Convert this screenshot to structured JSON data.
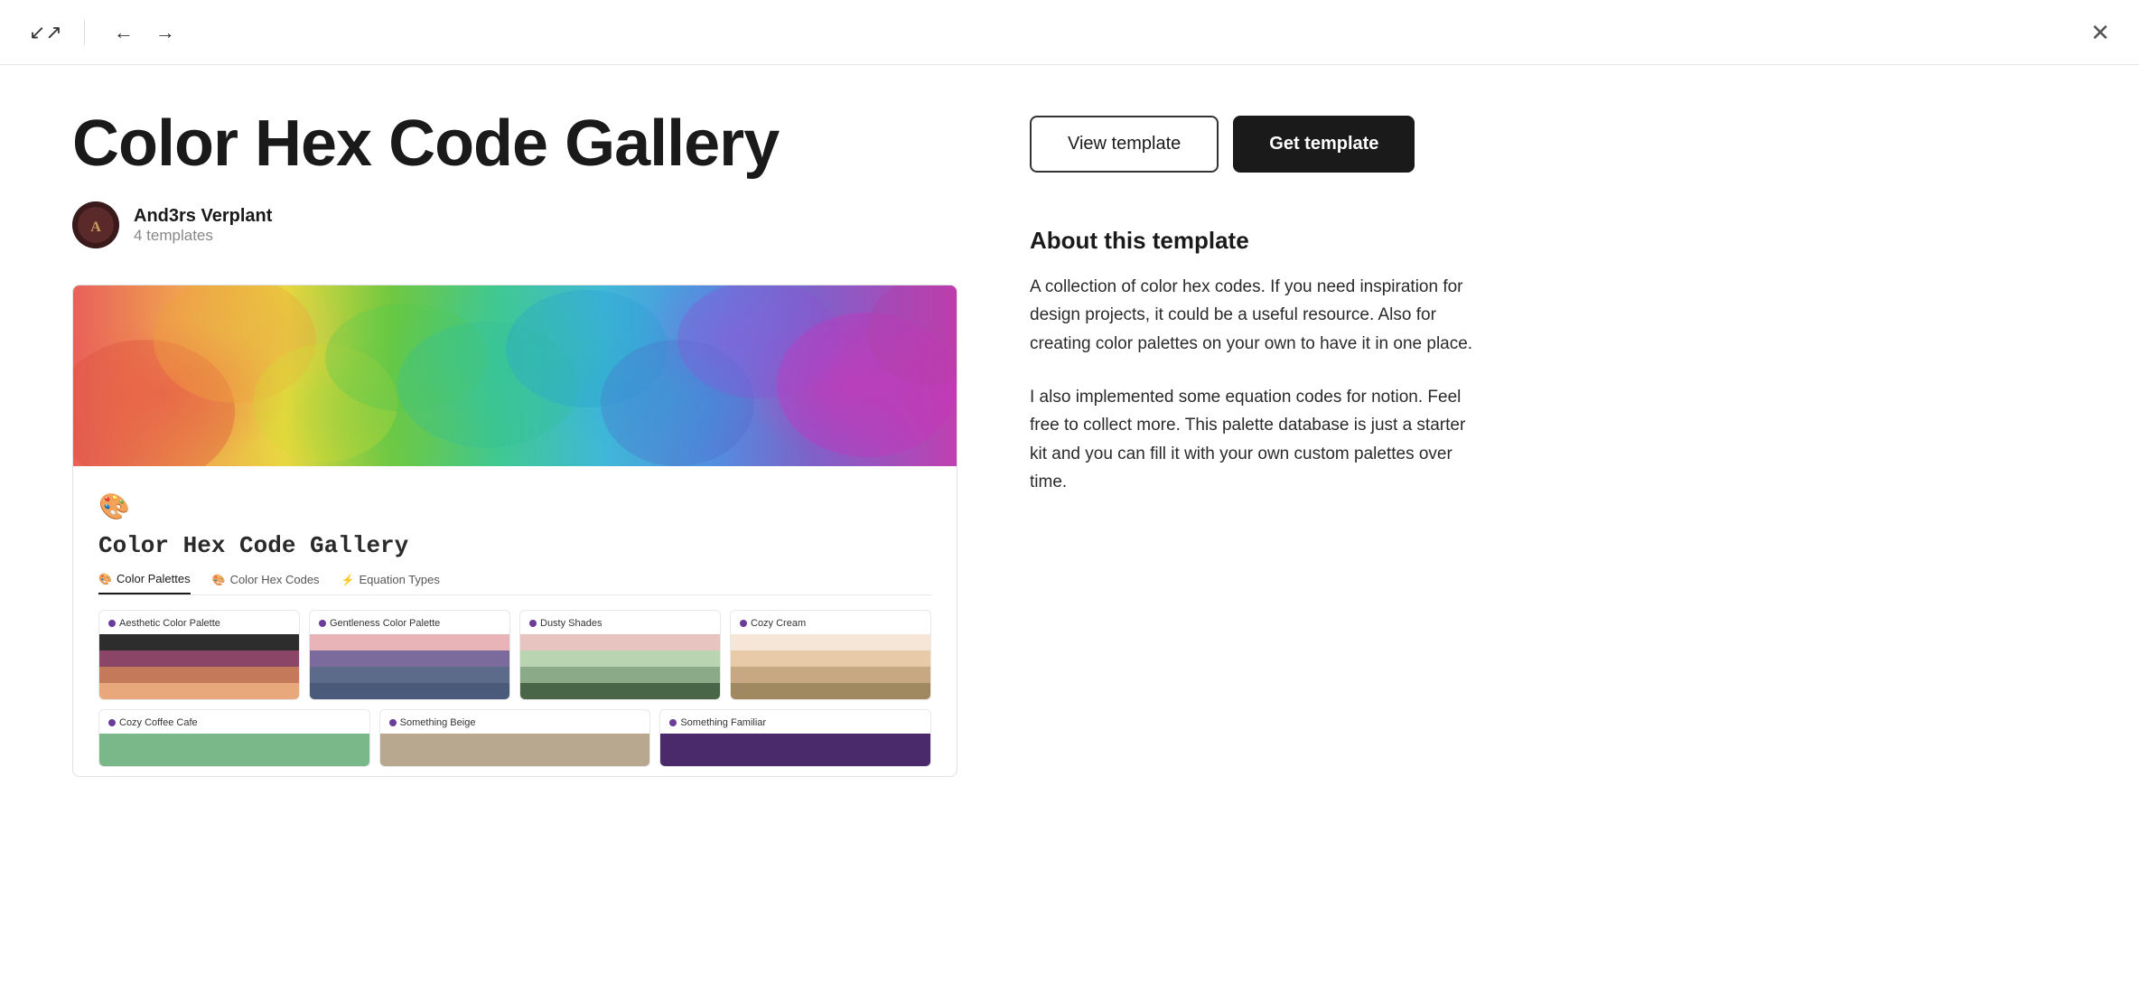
{
  "nav": {
    "expand_icon": "↙↗",
    "back_icon": "←",
    "forward_icon": "→",
    "close_icon": "✕"
  },
  "header": {
    "title": "Color Hex Code Gallery",
    "author_name": "And3rs Verplant",
    "author_templates": "4 templates"
  },
  "buttons": {
    "view_template": "View template",
    "get_template": "Get template"
  },
  "preview": {
    "icon": "🎨",
    "db_title": "Color Hex Code Gallery",
    "tabs": [
      {
        "label": "Color Palettes",
        "icon": "🎨",
        "active": true
      },
      {
        "label": "Color Hex Codes",
        "icon": "🎨",
        "active": false
      },
      {
        "label": "Equation Types",
        "icon": "⚡",
        "active": false
      }
    ],
    "palettes": [
      {
        "name": "Aesthetic Color Palette",
        "dot_color": "#6a3d9a",
        "swatches": [
          "#2d2d2d",
          "#8b4567",
          "#c47a5a",
          "#e8a87c"
        ]
      },
      {
        "name": "Gentleness Color Palette",
        "dot_color": "#6a3d9a",
        "swatches": [
          "#e8b4b8",
          "#7b6b9d",
          "#5c6b8a",
          "#4a5a7a"
        ]
      },
      {
        "name": "Dusty Shades",
        "dot_color": "#6a3d9a",
        "swatches": [
          "#e8c4c0",
          "#b8d4b0",
          "#8aaa88",
          "#4a6648"
        ]
      },
      {
        "name": "Cozy Cream",
        "dot_color": "#6a3d9a",
        "swatches": [
          "#f5e6d8",
          "#e8c9a8",
          "#c8a882",
          "#a08860"
        ]
      }
    ],
    "palettes_row2": [
      {
        "name": "Cozy Coffee Cafe",
        "dot_color": "#6a3d9a",
        "swatches": [
          "#7ab88a"
        ]
      },
      {
        "name": "Something Beige",
        "dot_color": "#6a3d9a",
        "swatches": [
          "#b8a890"
        ]
      },
      {
        "name": "Something Familiar",
        "dot_color": "#6a3d9a",
        "swatches": [
          "#4a2a6a"
        ]
      }
    ]
  },
  "about": {
    "title": "About this template",
    "paragraphs": [
      "A collection of color hex codes. If you need inspiration for design projects, it could be a useful resource. Also for creating color palettes on your own to have it in one place.",
      "I also implemented some equation codes for notion. Feel free to collect more. This palette database is just a starter kit and you can fill it with your own custom palettes over time."
    ]
  },
  "carousel": {
    "items": [
      {
        "label": "Aesthetic Color Palette"
      },
      {
        "label": "Cozy Cream"
      }
    ]
  }
}
